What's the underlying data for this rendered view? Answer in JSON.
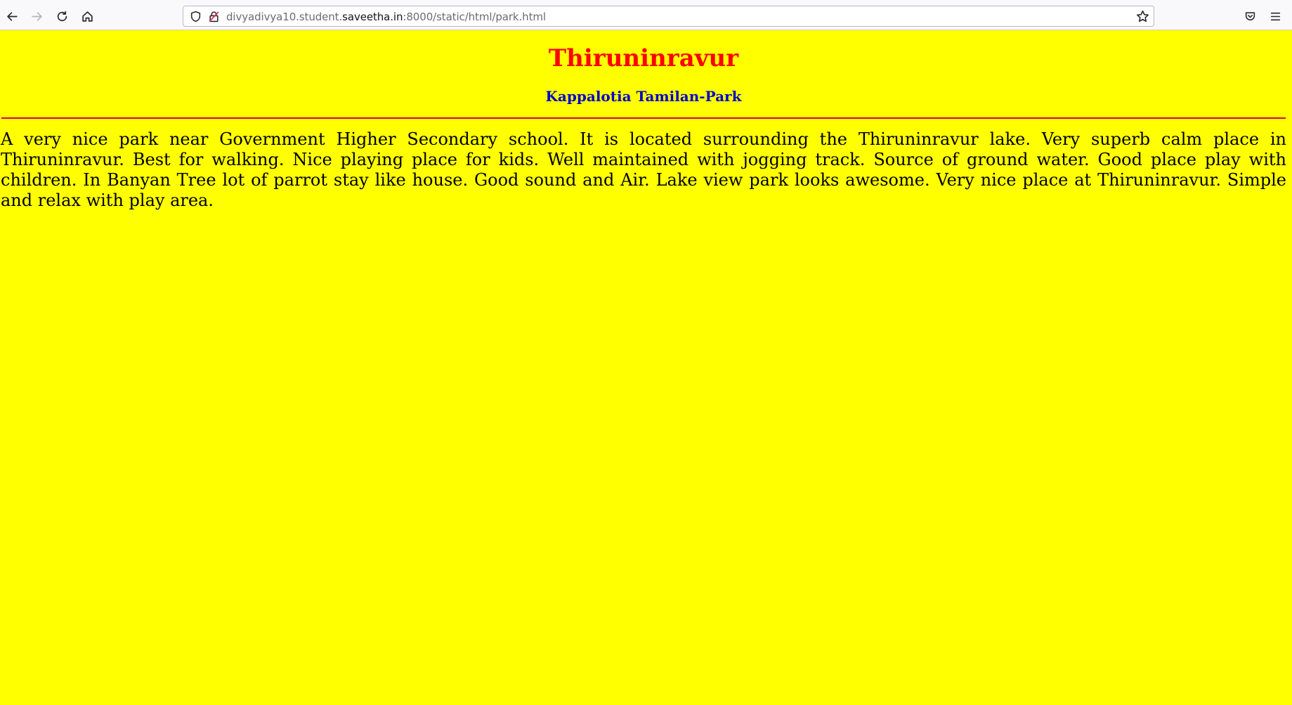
{
  "browser": {
    "url_prefix": "divyadivya10.student.",
    "url_domain": "saveetha.in",
    "url_suffix": ":8000/static/html/park.html",
    "icons": [
      "back-icon",
      "forward-icon",
      "reload-icon",
      "home-icon",
      "shield-icon",
      "lock-icon",
      "star-icon",
      "pocket-icon",
      "menu-icon"
    ]
  },
  "page": {
    "title": "Thiruninravur",
    "subtitle": "Kappalotia Tamilan-Park",
    "description": "A very nice park near Government Higher Secondary school. It is located surrounding the Thiruninravur lake. Very superb calm place in Thiruninravur. Best for walking. Nice playing place for kids. Well maintained with jogging track. Source of ground water. Good place play with children. In Banyan Tree lot of parrot stay like house. Good sound and Air. Lake view park looks awesome. Very nice place at Thiruninravur. Simple and relax with play area."
  },
  "colors": {
    "background": "#ffff00",
    "title": "#ff0000",
    "subtitle": "#0000cc",
    "divider": "#e0003a"
  }
}
